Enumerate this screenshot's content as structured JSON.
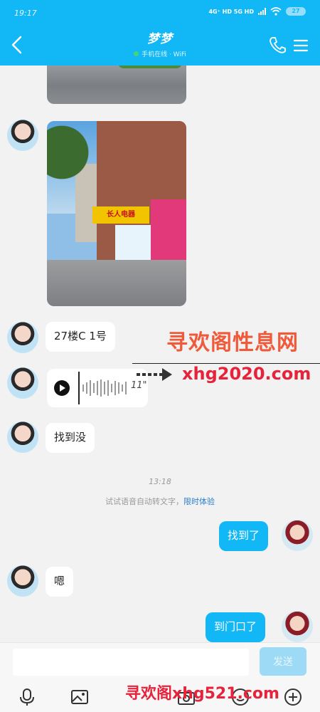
{
  "status": {
    "time": "19:17",
    "network": "4G⁺ HD  5G HD",
    "battery": "27"
  },
  "header": {
    "title": "梦梦",
    "subtitle": "手机在线 · WiFi"
  },
  "messages": {
    "address": "27楼C 1号",
    "voice_duration": "11\"",
    "found_question": "找到没",
    "found_reply": "找到了",
    "ok": "嗯",
    "at_door": "到门口了"
  },
  "photo": {
    "shop_sign": "长人电器"
  },
  "timestamp": "13:18",
  "tip": {
    "text": "试试语音自动转文字，",
    "link": "限时体验"
  },
  "input": {
    "placeholder": "",
    "send_label": "发送"
  },
  "watermark": {
    "line1": "寻欢阁性息网",
    "line2": "xhg2020.com",
    "line3": "寻欢阁xhg521.com"
  },
  "icons": [
    "back-icon",
    "phone-icon",
    "menu-icon",
    "microphone-icon",
    "image-icon",
    "camera-icon",
    "emoji-icon",
    "plus-icon",
    "play-icon"
  ],
  "colors": {
    "accent": "#12b7f5",
    "send_disabled": "#9cdaf5",
    "online": "#4cd964",
    "watermark_red": "#e6233b"
  }
}
